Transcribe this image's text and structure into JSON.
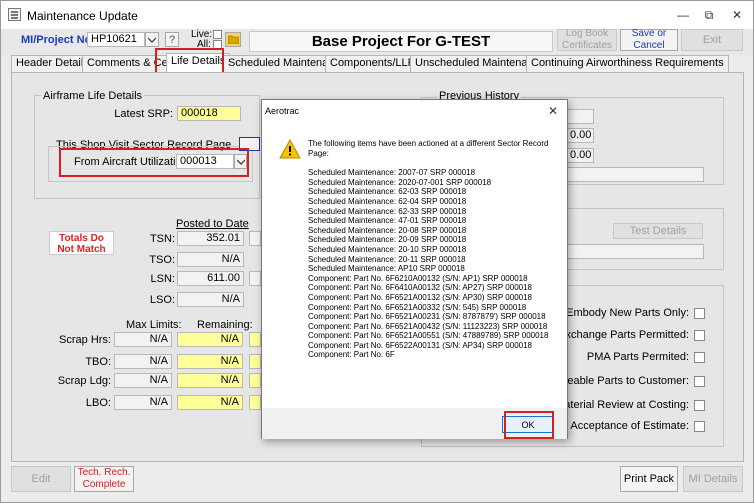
{
  "window": {
    "title": "Maintenance Update",
    "minimize": "—",
    "restore": "⧉",
    "close": "✕"
  },
  "header": {
    "project_label": "MI/Project No:",
    "project_value": "HP10621",
    "help_label": "?",
    "live_label": "Live:",
    "all_label": "All:",
    "project_title": "Base Project For G-TEST",
    "log_book_btn": "Log Book Certificates",
    "save_cancel_btn": "Save or Cancel",
    "exit_btn": "Exit"
  },
  "tabs": [
    "Header Details",
    "Comments & Certs",
    "Life Details",
    "Scheduled Maintenance",
    "Components/LLP's",
    "Unscheduled Maintenance",
    "Continuing Airworthiness Requirements"
  ],
  "active_tab": "Life Details",
  "airframe": {
    "group_title": "Airframe Life Details",
    "latest_srp_label": "Latest SRP:",
    "latest_srp": "000018",
    "sector_page_label": "This Shop Visit Sector Record Page",
    "from_util_label": "From Aircraft Utilization:",
    "from_util_value": "000013"
  },
  "totals_warning": "Totals Do Not Match",
  "posted_to_date": "Posted to Date",
  "life_rows": [
    {
      "label": "TSN:",
      "value": "352.01"
    },
    {
      "label": "TSO:",
      "value": "N/A"
    },
    {
      "label": "LSN:",
      "value": "611.00"
    },
    {
      "label": "LSO:",
      "value": "N/A"
    }
  ],
  "limits": {
    "max_label": "Max Limits:",
    "remaining_label": "Remaining:",
    "rows": [
      {
        "label": "Scrap Hrs:",
        "max": "N/A",
        "remaining": "N/A"
      },
      {
        "label": "TBO:",
        "max": "N/A",
        "remaining": "N/A"
      },
      {
        "label": "Scrap Ldg:",
        "max": "N/A",
        "remaining": "N/A"
      },
      {
        "label": "LBO:",
        "max": "N/A",
        "remaining": "N/A"
      }
    ]
  },
  "previous_history": {
    "title": "Previous History",
    "val1": "0.00",
    "val2": "0.00"
  },
  "test_details_btn": "Test Details",
  "options": [
    "Embody New Parts Only:",
    "nit Exchange Parts Permitted:",
    "PMA Parts Permited:",
    "serviceable Parts to Customer:",
    "old Material Review at Costing:",
    "or to Acceptance of Estimate:"
  ],
  "footer": {
    "edit_btn": "Edit",
    "tech_rech_btn": "Tech. Rech. Complete",
    "print_pack_btn": "Print Pack",
    "mi_details_btn": "MI Details"
  },
  "dialog": {
    "title": "Aerotrac",
    "close": "✕",
    "message": "The following items have been actioned at a different Sector Record Page:",
    "items": [
      "Scheduled Maintenance: 2007-07 SRP 000018",
      "Scheduled Maintenance: 2020-07-001 SRP 000018",
      "Scheduled Maintenance: 62-03 SRP 000018",
      "Scheduled Maintenance: 62-04 SRP 000018",
      "Scheduled Maintenance: 62-33 SRP 000018",
      "Scheduled Maintenance: 47-01 SRP 000018",
      "Scheduled Maintenance: 20-08 SRP 000018",
      "Scheduled Maintenance: 20-09 SRP 000018",
      "Scheduled Maintenance: 20-10 SRP 000018",
      "Scheduled Maintenance: 20-11 SRP 000018",
      "Scheduled Maintenance: AP10 SRP 000018",
      "Component: Part No. 6F6210A00132 (S/N: AP1) SRP 000018",
      "Component: Part No. 6F6410A00132 (S/N: AP27) SRP 000018",
      "Component: Part No. 6F6521A00132 (S/N: AP30) SRP 000018",
      "Component: Part No. 6F6521A00332 (S/N: 545) SRP 000018",
      "Component: Part No. 6F6521A00231 (S/N: 8787879') SRP 000018",
      "Component: Part No. 6F6521A00432 (S/N: 11123223) SRP 000018",
      "Component: Part No. 6F6521A00551 (S/N: 47889789) SRP 000018",
      "Component: Part No. 6F6522A00131 (S/N: AP34) SRP 000018",
      "Component: Part No. 6F"
    ],
    "ok_btn": "OK"
  },
  "colors": {
    "accent": "#1a3bb8",
    "warning_red": "#e02020",
    "highlight_box": "#d42020",
    "field_yellow": "#ffff99"
  }
}
